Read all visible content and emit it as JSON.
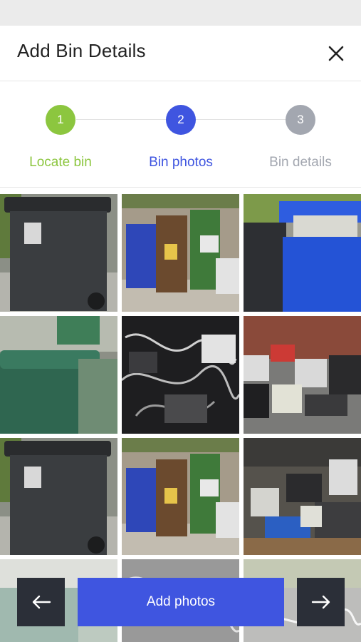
{
  "header": {
    "title": "Add Bin Details",
    "close_icon": "close-icon"
  },
  "stepper": {
    "steps": [
      {
        "number": "1",
        "label": "Locate bin",
        "color": "#8cc63f",
        "state": "complete"
      },
      {
        "number": "2",
        "label": "Bin photos",
        "color": "#3f55e0",
        "state": "active"
      },
      {
        "number": "3",
        "label": "Bin details",
        "color": "#a3a7b0",
        "state": "pending"
      }
    ]
  },
  "photos": [
    {
      "subject": "black wheelie bin"
    },
    {
      "subject": "blue, brown and green bins"
    },
    {
      "subject": "overflowing blue bin"
    },
    {
      "subject": "green wheelie bin"
    },
    {
      "subject": "tangled cables"
    },
    {
      "subject": "old computers and printers"
    },
    {
      "subject": "black wheelie bin"
    },
    {
      "subject": "blue, brown and green bins"
    },
    {
      "subject": "electronic waste pile"
    },
    {
      "subject": "green wheelie bin"
    },
    {
      "subject": "tangled cables"
    },
    {
      "subject": "old computers and printers"
    }
  ],
  "actions": {
    "back_icon": "arrow-left-icon",
    "add_photos_label": "Add photos",
    "next_icon": "arrow-right-icon"
  },
  "colors": {
    "accent": "#3f55e0",
    "complete": "#8cc63f",
    "pending": "#a3a7b0",
    "nav_button": "#2b2f38"
  }
}
